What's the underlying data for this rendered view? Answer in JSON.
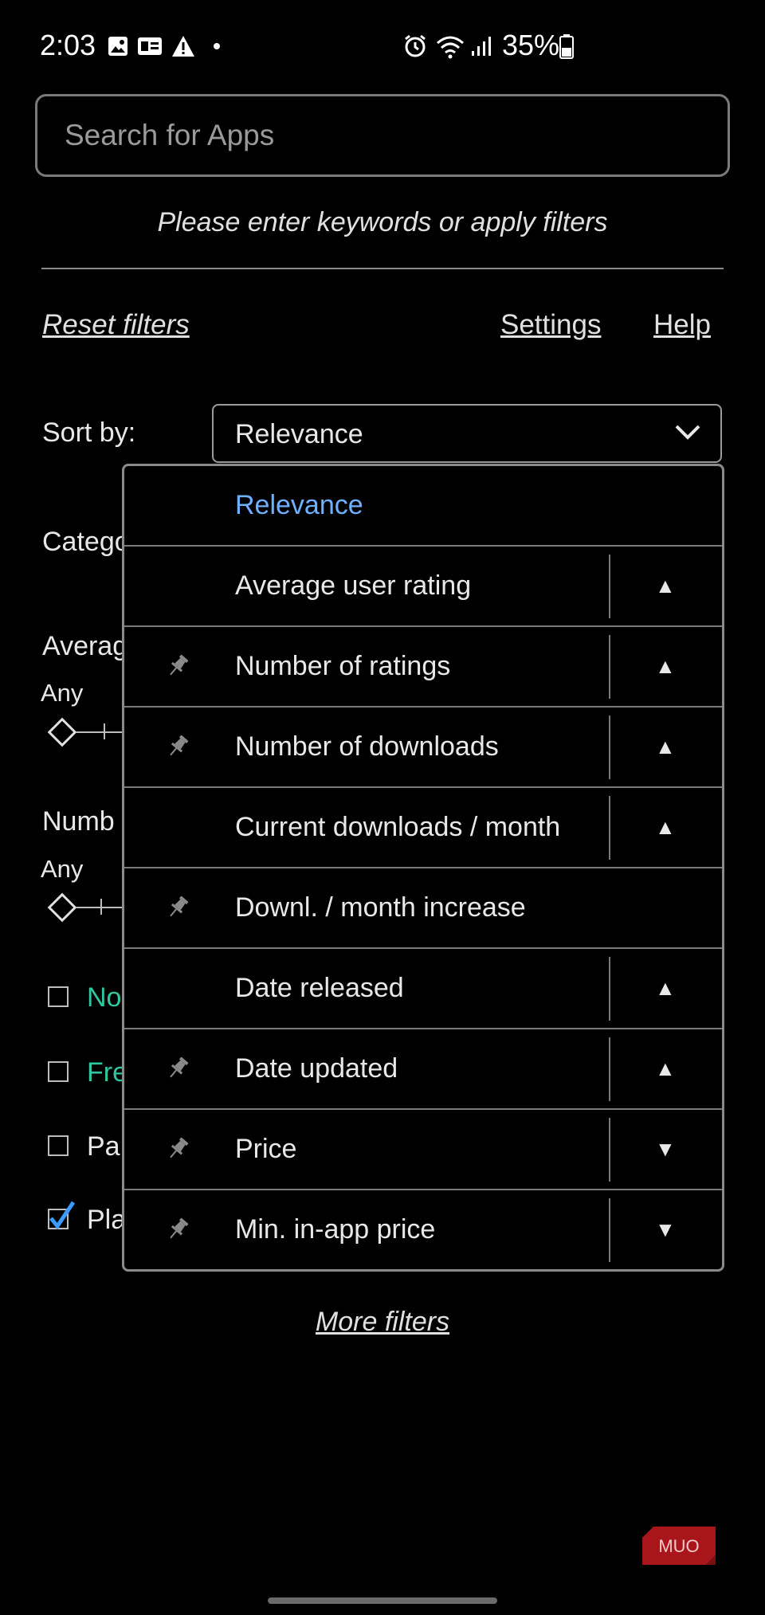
{
  "status_bar": {
    "time": "2:03",
    "battery": "35%"
  },
  "search": {
    "placeholder": "Search for Apps"
  },
  "hint": "Please enter keywords or apply filters",
  "links": {
    "reset": "Reset filters",
    "settings": "Settings",
    "help": "Help",
    "more_filters": "More filters"
  },
  "sort": {
    "label": "Sort by:",
    "selected": "Relevance"
  },
  "background": {
    "category": "Catego",
    "average": "Averag",
    "any1": "Any",
    "number": "Numb",
    "any2": "Any",
    "cb1": "No",
    "cb2": "Fre",
    "cb3": "Pa",
    "cb4": "Pla"
  },
  "dropdown": {
    "options": [
      {
        "label": "Relevance",
        "pinned": false,
        "arrow": ""
      },
      {
        "label": "Average user rating",
        "pinned": false,
        "arrow": "▲"
      },
      {
        "label": "Number of ratings",
        "pinned": true,
        "arrow": "▲"
      },
      {
        "label": "Number of downloads",
        "pinned": true,
        "arrow": "▲"
      },
      {
        "label": "Current downloads / month",
        "pinned": false,
        "arrow": "▲"
      },
      {
        "label": "Downl. / month increase",
        "pinned": true,
        "arrow": ""
      },
      {
        "label": "Date released",
        "pinned": false,
        "arrow": "▲"
      },
      {
        "label": "Date updated",
        "pinned": true,
        "arrow": "▲"
      },
      {
        "label": "Price",
        "pinned": true,
        "arrow": "▼"
      },
      {
        "label": "Min. in-app price",
        "pinned": true,
        "arrow": "▼"
      }
    ]
  },
  "colors": {
    "accent": "#6fb0ff",
    "green": "#2fc7a0",
    "checkbox_blue": "#3b9bff"
  },
  "logo_text": "MUO"
}
